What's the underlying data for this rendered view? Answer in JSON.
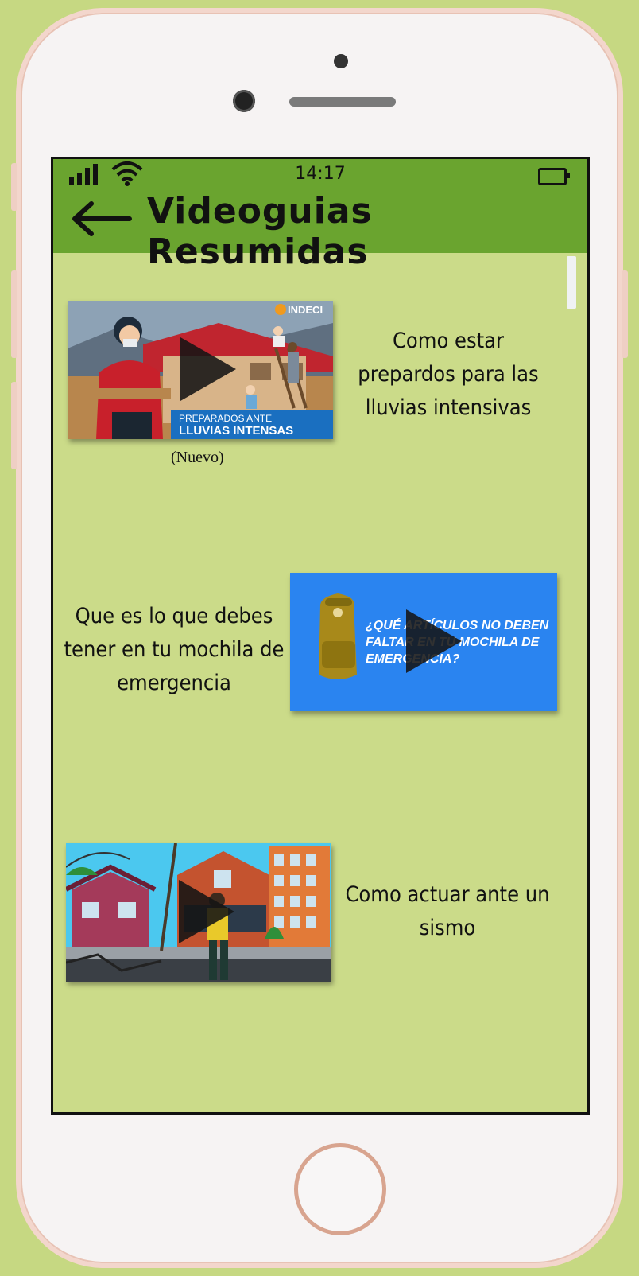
{
  "header": {
    "time": "14:17",
    "title": "Videoguias Resumidas"
  },
  "videos": [
    {
      "title": "Como estar prepardos para las lluvias intensivas",
      "badge": "(Nuevo)",
      "thumb_logo": "INDECI",
      "thumb_line1": "PREPARADOS ANTE",
      "thumb_line2": "LLUVIAS INTENSAS"
    },
    {
      "title": "Que es lo que debes tener en tu mochila de emergencia",
      "thumb_text": "¿QUÉ ARTÍCULOS NO DEBEN FALTAR EN TU MOCHILA DE EMERGENCIA?"
    },
    {
      "title": "Como actuar ante un sismo"
    }
  ],
  "colors": {
    "background": "#c6d882",
    "header": "#6aa42f",
    "content": "#cbdb89",
    "accent_blue": "#2a84f0"
  },
  "icons": [
    "signal-icon",
    "wifi-icon",
    "battery-icon",
    "back-arrow-icon",
    "play-icon"
  ]
}
